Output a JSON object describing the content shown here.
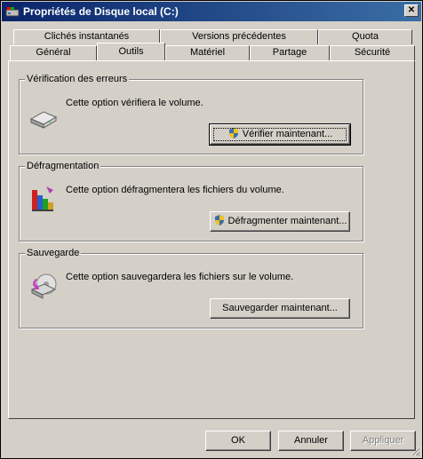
{
  "window": {
    "title": "Propriétés de Disque local (C:)",
    "close_label": "✕"
  },
  "tabs_row1": [
    {
      "label": "Clichés instantanés"
    },
    {
      "label": "Versions précédentes"
    },
    {
      "label": "Quota"
    }
  ],
  "tabs_row2": [
    {
      "label": "Général"
    },
    {
      "label": "Outils",
      "active": true
    },
    {
      "label": "Matériel"
    },
    {
      "label": "Partage"
    },
    {
      "label": "Sécurité"
    }
  ],
  "groups": {
    "error_check": {
      "title": "Vérification des erreurs",
      "description": "Cette option vérifiera le volume.",
      "button_label": "Vérifier maintenant...",
      "icon": "disk-check-icon"
    },
    "defrag": {
      "title": "Défragmentation",
      "description": "Cette option défragmentera les fichiers du volume.",
      "button_label": "Défragmenter maintenant...",
      "icon": "defrag-icon"
    },
    "backup": {
      "title": "Sauvegarde",
      "description": "Cette option sauvegardera les fichiers sur le volume.",
      "button_label": "Sauvegarder maintenant...",
      "icon": "backup-icon"
    }
  },
  "footer": {
    "ok_label": "OK",
    "cancel_label": "Annuler",
    "apply_label": "Appliquer"
  }
}
